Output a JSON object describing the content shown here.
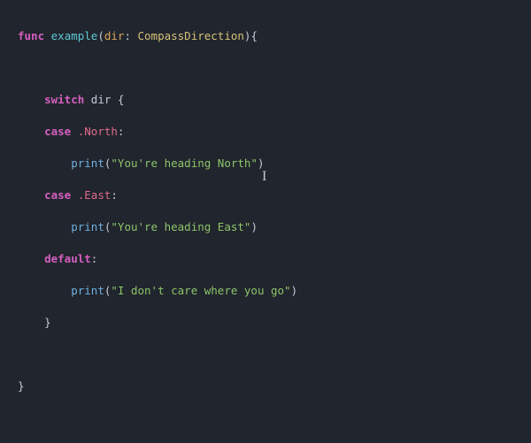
{
  "code": {
    "func_kw": "func",
    "func_name": "example",
    "open_paren": "(",
    "param_name": "dir",
    "colon_space": ": ",
    "param_type": "CompassDirection",
    "close_paren_brace": "){",
    "switch_kw": "switch",
    "switch_space": " ",
    "switch_var": "dir",
    "switch_space_brace": " {",
    "case_kw_1": "case",
    "case_val_1": " .North",
    "case_colon_1": ":",
    "print_1": "print",
    "p1_open": "(",
    "str_1": "\"You're heading North\"",
    "p1_close": ")",
    "case_kw_2": "case",
    "case_val_2": " .East",
    "case_colon_2": ":",
    "print_2": "print",
    "p2_open": "(",
    "str_2": "\"You're heading East\"",
    "p2_close": ")",
    "default_kw": "default",
    "default_colon": ":",
    "print_3": "print",
    "p3_open": "(",
    "str_3": "\"I don't care where you go\"",
    "p3_close": ")",
    "close_brace_inner": "}",
    "close_brace_outer": "}",
    "indent1": "    ",
    "indent2": "        "
  },
  "cursor_glyph": "I"
}
